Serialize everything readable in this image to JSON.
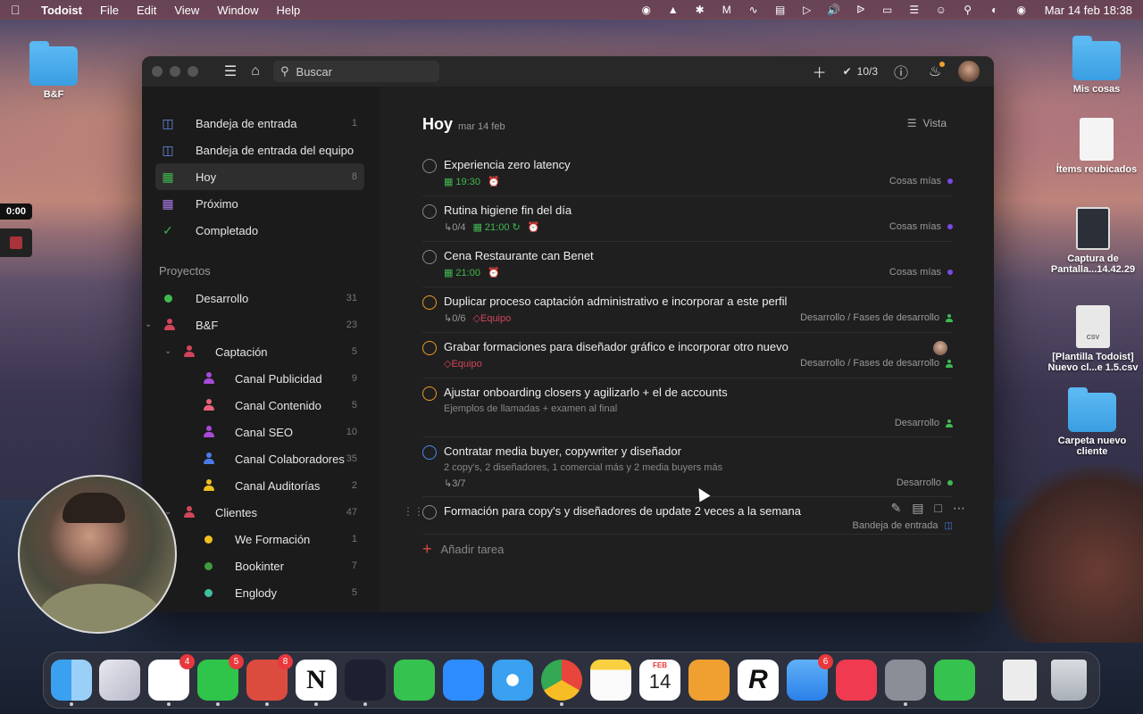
{
  "menubar": {
    "app_name": "Todoist",
    "items": [
      "File",
      "Edit",
      "View",
      "Window",
      "Help"
    ],
    "clock": "Mar 14 feb 18:38"
  },
  "desktop": {
    "left_folder": "B&F",
    "mis_cosas": "Mis cosas",
    "items_reubicados": "Ítems reubicados",
    "captura": "Captura de Pantalla...14.42.29",
    "plantilla": "[Plantilla Todoist] Nuevo cl...e 1.5.csv",
    "carpeta": "Carpeta nuevo cliente"
  },
  "overlay": {
    "timer": "0:00"
  },
  "topbar": {
    "search_placeholder": "Buscar",
    "karma": "10/3"
  },
  "sidebar": {
    "inbox": {
      "label": "Bandeja de entrada",
      "count": "1"
    },
    "team_inbox": {
      "label": "Bandeja de entrada del equipo"
    },
    "today": {
      "label": "Hoy",
      "count": "8"
    },
    "upcoming": {
      "label": "Próximo"
    },
    "completed": {
      "label": "Completado"
    },
    "projects_title": "Proyectos",
    "projects": [
      {
        "label": "Desarrollo",
        "count": "31",
        "color": "#3fb950"
      },
      {
        "label": "B&F",
        "count": "23",
        "color": "#d1455c"
      },
      {
        "label": "Captación",
        "count": "5",
        "color": "#d1455c"
      },
      {
        "label": "Canal Publicidad",
        "count": "9",
        "color": "#a84ad8"
      },
      {
        "label": "Canal Contenido",
        "count": "5",
        "color": "#e8627a"
      },
      {
        "label": "Canal SEO",
        "count": "10",
        "color": "#a84ad8"
      },
      {
        "label": "Canal Colaboradores",
        "count": "35",
        "color": "#4a7ae8"
      },
      {
        "label": "Canal Auditorías",
        "count": "2",
        "color": "#f0c020"
      },
      {
        "label": "Clientes",
        "count": "47",
        "color": "#d1455c"
      },
      {
        "label": "We Formación",
        "count": "1",
        "color": "#f0c020"
      },
      {
        "label": "Bookinter",
        "count": "7",
        "color": "#3f9a40"
      },
      {
        "label": "Englody",
        "count": "5",
        "color": "#3fc0a0"
      }
    ]
  },
  "main": {
    "title": "Hoy",
    "date": "mar 14 feb",
    "view_label": "Vista",
    "add_task": "Añadir tarea",
    "tasks": [
      {
        "title": "Experiencia zero latency",
        "time": "19:30",
        "project": "Cosas mías"
      },
      {
        "title": "Rutina higiene fin del día",
        "subtasks": "0/4",
        "time": "21:00",
        "project": "Cosas mías"
      },
      {
        "title": "Cena Restaurante can Benet",
        "time": "21:00",
        "project": "Cosas mías"
      },
      {
        "title": "Duplicar proceso captación administrativo e incorporar a este perfil",
        "subtasks": "0/6",
        "label": "Equipo",
        "project": "Desarrollo / Fases de desarrollo"
      },
      {
        "title": "Grabar formaciones para diseñador gráfico e incorporar otro nuevo",
        "label": "Equipo",
        "project": "Desarrollo / Fases de desarrollo"
      },
      {
        "title": "Ajustar onboarding closers y agilizarlo + el de accounts",
        "description": "Ejemplos de llamadas + examen al final",
        "project": "Desarrollo"
      },
      {
        "title": "Contratar media buyer, copywriter y diseñador",
        "description": "2 copy's, 2 diseñadores, 1 comercial más y 2 media buyers más",
        "subtasks": "3/7",
        "project": "Desarrollo"
      },
      {
        "title": "Formación para copy's y diseñadores de update 2 veces a la semana",
        "project": "Bandeja de entrada"
      }
    ]
  },
  "dock": {
    "badges": {
      "slack": "4",
      "whatsapp": "5",
      "todoist": "8",
      "mail": "6"
    },
    "calendar_month": "FEB",
    "calendar_day": "14"
  }
}
